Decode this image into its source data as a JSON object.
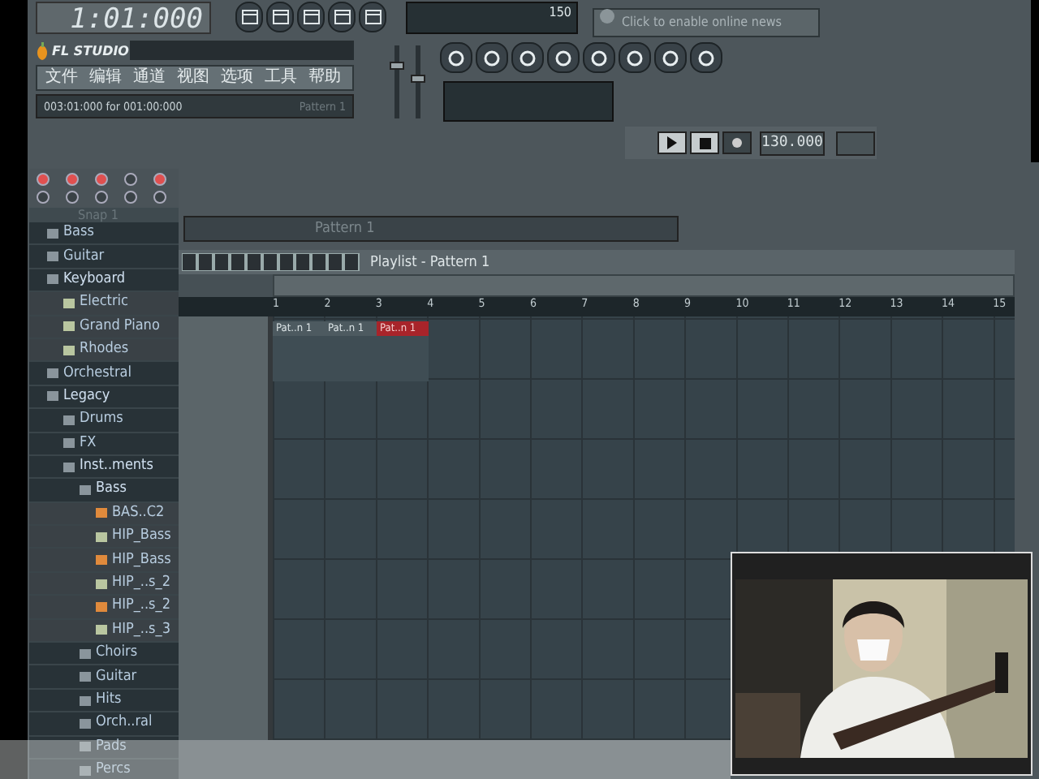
{
  "time_display": "1:01:000",
  "meter": {
    "value": "150"
  },
  "news": {
    "placeholder": "Click to enable online news"
  },
  "sliders": [
    {
      "level": 0.75
    },
    {
      "level": 0.55
    }
  ],
  "main_window": {
    "logo": "FL STUDIO",
    "menu": [
      "文件",
      "编辑",
      "通道",
      "视图",
      "选项",
      "工具",
      "帮助"
    ],
    "hint": "003:01:000 for 001:00:000",
    "pattern": "Pattern 1"
  },
  "transport": {
    "tempo": "130.000"
  },
  "browser": {
    "title": "Snap 1",
    "tree": [
      {
        "label": "Bass",
        "kind": "folder"
      },
      {
        "label": "Guitar",
        "kind": "folder"
      },
      {
        "label": "Keyboard",
        "kind": "folder",
        "expanded": true,
        "children": [
          {
            "label": "Electric",
            "kind": "plugin"
          },
          {
            "label": "Grand Piano",
            "kind": "plugin"
          },
          {
            "label": "Rhodes",
            "kind": "plugin"
          }
        ]
      },
      {
        "label": "Orchestral",
        "kind": "folder"
      },
      {
        "label": "Legacy",
        "kind": "folder",
        "expanded": true,
        "children": [
          {
            "label": "Drums",
            "kind": "folder"
          },
          {
            "label": "FX",
            "kind": "folder"
          },
          {
            "label": "Inst..ments",
            "kind": "folder",
            "expanded": true,
            "children": [
              {
                "label": "Bass",
                "kind": "folder",
                "expanded": true,
                "children": [
                  {
                    "label": "BAS..C2",
                    "kind": "sample"
                  },
                  {
                    "label": "HIP_Bass",
                    "kind": "plugin"
                  },
                  {
                    "label": "HIP_Bass",
                    "kind": "sample"
                  },
                  {
                    "label": "HIP_..s_2",
                    "kind": "plugin"
                  },
                  {
                    "label": "HIP_..s_2",
                    "kind": "sample"
                  },
                  {
                    "label": "HIP_..s_3",
                    "kind": "plugin"
                  }
                ]
              },
              {
                "label": "Choirs",
                "kind": "folder"
              },
              {
                "label": "Guitar",
                "kind": "folder"
              },
              {
                "label": "Hits",
                "kind": "folder"
              },
              {
                "label": "Orch..ral",
                "kind": "folder"
              },
              {
                "label": "Pads",
                "kind": "folder"
              },
              {
                "label": "Percs",
                "kind": "folder"
              }
            ]
          }
        ]
      }
    ]
  },
  "pattern_bar": {
    "pattern": "Pattern 1"
  },
  "playlist": {
    "title": "Playlist - Pattern 1",
    "ruler": [
      "1",
      "2",
      "3",
      "4",
      "5",
      "6",
      "7",
      "8",
      "9",
      "10",
      "11",
      "12",
      "13",
      "14",
      "15"
    ],
    "clips": [
      {
        "label": "Pat..n 1",
        "selected": false
      },
      {
        "label": "Pat..n 1",
        "selected": false
      },
      {
        "label": "Pat..n 1",
        "selected": true
      }
    ]
  }
}
